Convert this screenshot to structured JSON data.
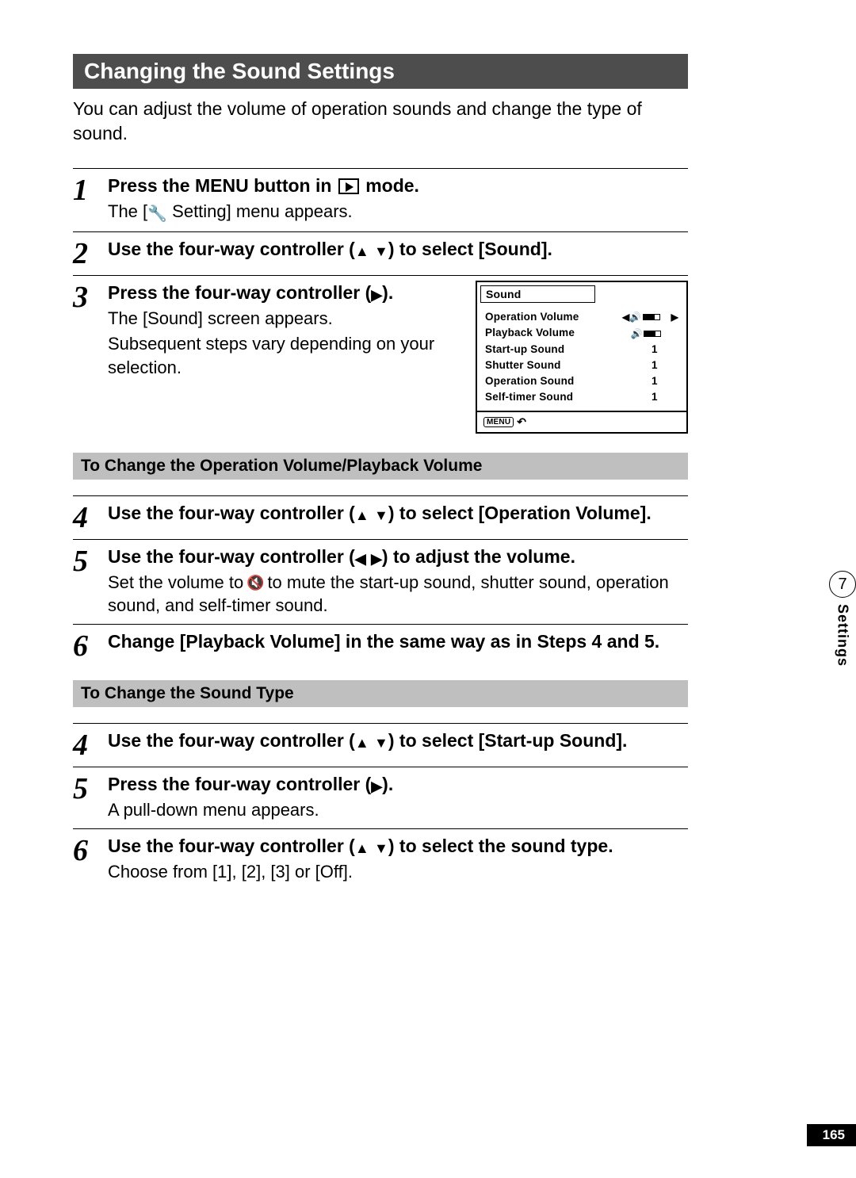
{
  "section_title": "Changing the Sound Settings",
  "intro": "You can adjust the volume of operation sounds and change the type of sound.",
  "steps_main": [
    {
      "num": "1",
      "title_pre": "Press the ",
      "title_menu": "MENU",
      "title_mid": " button in ",
      "title_post": " mode.",
      "desc_pre": "The [",
      "desc_post": " Setting] menu appears."
    },
    {
      "num": "2",
      "title_pre": "Use the four-way controller (",
      "title_post": ") to select [Sound]."
    },
    {
      "num": "3",
      "title_pre": "Press the four-way controller (",
      "title_post": ").",
      "desc1": "The [Sound] screen appears.",
      "desc2": "Subsequent steps vary depending on your selection."
    }
  ],
  "lcd": {
    "title": "Sound",
    "rows": [
      {
        "label": "Operation Volume",
        "vol": true,
        "arrows": true
      },
      {
        "label": "Playback Volume",
        "vol": true
      },
      {
        "label": "Start-up Sound",
        "value": "1"
      },
      {
        "label": "Shutter Sound",
        "value": "1"
      },
      {
        "label": "Operation Sound",
        "value": "1"
      },
      {
        "label": "Self-timer Sound",
        "value": "1"
      }
    ],
    "footer_btn": "MENU"
  },
  "sub1": {
    "header": "To Change the Operation Volume/Playback Volume",
    "steps": [
      {
        "num": "4",
        "title_pre": "Use the four-way controller (",
        "title_post": ") to select [Operation Volume]."
      },
      {
        "num": "5",
        "title_pre": "Use the four-way controller (",
        "title_post": ") to adjust the volume.",
        "desc_pre": "Set the volume to ",
        "desc_post": " to mute the start-up sound, shutter sound, operation sound, and self-timer sound."
      },
      {
        "num": "6",
        "title": "Change [Playback Volume] in the same way as in Steps 4 and 5."
      }
    ]
  },
  "sub2": {
    "header": "To Change the Sound Type",
    "steps": [
      {
        "num": "4",
        "title_pre": "Use the four-way controller (",
        "title_post": ") to select [Start-up Sound]."
      },
      {
        "num": "5",
        "title_pre": "Press the four-way controller (",
        "title_post": ").",
        "desc": "A pull-down menu appears."
      },
      {
        "num": "6",
        "title_pre": "Use the four-way controller (",
        "title_post": ") to select the sound type.",
        "desc": "Choose from [1], [2], [3] or [Off]."
      }
    ]
  },
  "side": {
    "chapter": "7",
    "label": "Settings"
  },
  "page_number": "165"
}
